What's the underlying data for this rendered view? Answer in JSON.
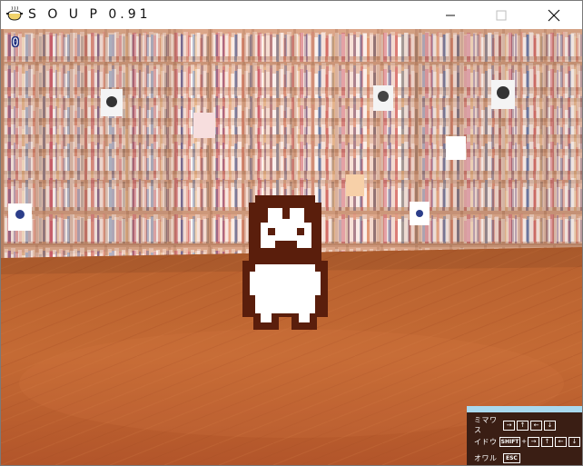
{
  "window": {
    "title": "S O U P 0.91",
    "app_icon": "soup-pot-icon",
    "controls": {
      "minimize_icon": "minimize-icon",
      "maximize_icon": "maximize-icon",
      "close_icon": "close-icon"
    }
  },
  "hud": {
    "counter": "0"
  },
  "scene": {
    "environment": "library room with bookshelves on walls and wooden parquet floor",
    "character": "pixel-art figure with long dark hair and white body"
  },
  "controls_help": {
    "rows": [
      {
        "label": "ミマワス",
        "keys": [
          "→",
          "↑",
          "←",
          "↓"
        ]
      },
      {
        "label": "イドウ",
        "modifier": "SHIFT",
        "modifier_plus": "+",
        "keys": [
          "→",
          "↑",
          "←",
          "↓"
        ]
      },
      {
        "label": "オワル",
        "keys": [
          "ESC"
        ]
      }
    ]
  },
  "colors": {
    "floor": "#b65a2a",
    "panel_bg": "#3a1e14",
    "panel_accent": "#a9d9ee",
    "character_dark": "#5a1e0c",
    "character_light": "#ffffff"
  }
}
